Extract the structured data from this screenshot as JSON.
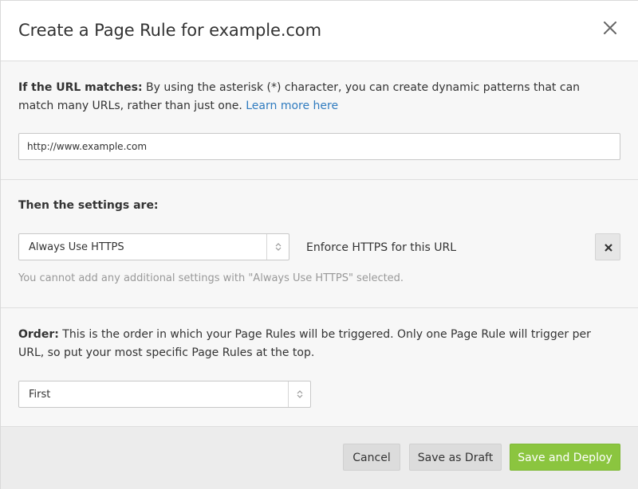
{
  "header": {
    "title": "Create a Page Rule for example.com"
  },
  "url_section": {
    "label": "If the URL matches:",
    "text": " By using the asterisk (*) character, you can create dynamic patterns that can match many URLs, rather than just one. ",
    "link": "Learn more here",
    "input_value": "http://www.example.com"
  },
  "settings_section": {
    "heading": "Then the settings are:",
    "setting_value": "Always Use HTTPS",
    "setting_description": "Enforce HTTPS for this URL",
    "note": "You cannot add any additional settings with \"Always Use HTTPS\" selected."
  },
  "order_section": {
    "label": "Order:",
    "text": " This is the order in which your Page Rules will be triggered. Only one Page Rule will trigger per URL, so put your most specific Page Rules at the top.",
    "value": "First"
  },
  "footer": {
    "cancel": "Cancel",
    "save_draft": "Save as Draft",
    "save_deploy": "Save and Deploy"
  },
  "icons": {
    "close": "close-icon",
    "remove": "remove-icon",
    "select_arrows": "select-arrows-icon"
  },
  "colors": {
    "accent_green": "#8bc53f",
    "link_blue": "#2f7bbf",
    "note_gray": "#999999"
  }
}
